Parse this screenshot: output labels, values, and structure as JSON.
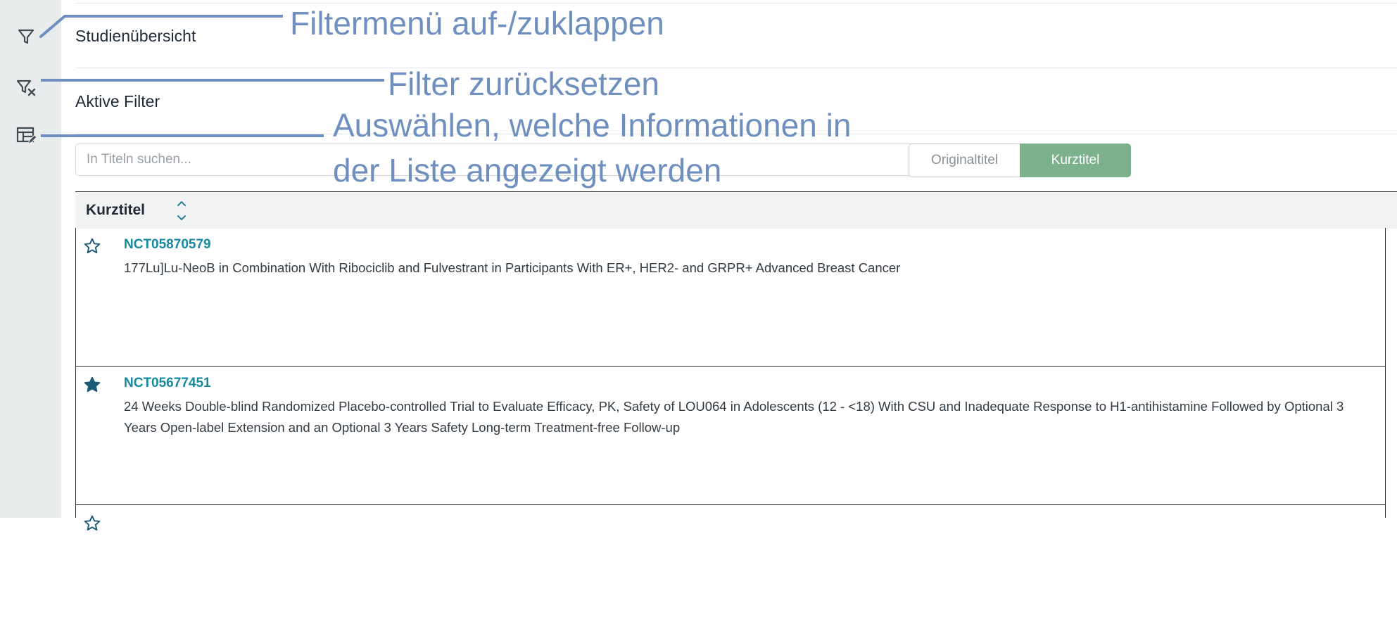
{
  "sidebar": {
    "filter_toggle_icon": "filter-icon",
    "filter_reset_icon": "filter-clear-icon",
    "column_config_icon": "table-edit-icon"
  },
  "sections": {
    "overview_title": "Studienübersicht",
    "active_filters_title": "Aktive Filter"
  },
  "search": {
    "placeholder": "In Titeln suchen..."
  },
  "title_toggle": {
    "original_label": "Originaltitel",
    "short_label": "Kurztitel",
    "selected": "Kurztitel"
  },
  "table": {
    "column_header": "Kurztitel",
    "rows": [
      {
        "id": "NCT05870579",
        "title": "177Lu]Lu-NeoB in Combination With Ribociclib and Fulvestrant in Participants With ER+, HER2- and GRPR+ Advanced Breast Cancer",
        "starred": false
      },
      {
        "id": "NCT05677451",
        "title": "24 Weeks Double-blind Randomized Placebo-controlled Trial to Evaluate Efficacy, PK, Safety of LOU064 in Adolescents (12 - <18) With CSU and Inadequate Response to H1-antihistamine Followed by Optional 3 Years Open-label Extension and an Optional 3 Years Safety Long-term Treatment-free Follow-up",
        "starred": true
      }
    ]
  },
  "annotations": {
    "filter_toggle": "Filtermenü auf-/zuklappen",
    "filter_reset": "Filter zurücksetzen",
    "column_config_line1": "Auswählen, welche Informationen in",
    "column_config_line2": "der Liste angezeigt werden"
  },
  "colors": {
    "accent_green": "#7db08c",
    "link_teal": "#17899d",
    "annotation_blue": "#6f8fbf",
    "star_dark": "#1a5a78"
  }
}
